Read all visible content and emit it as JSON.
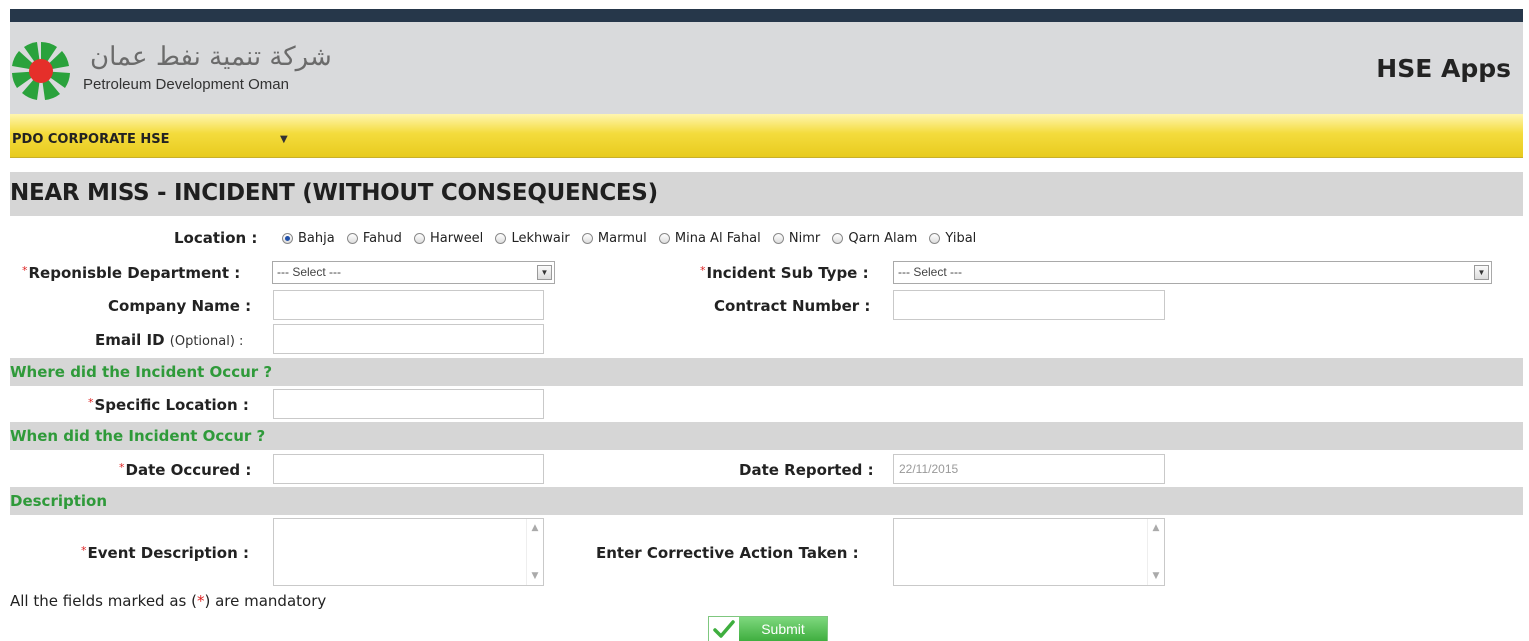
{
  "header": {
    "company_arabic": "شركة تنمية نفط عمان",
    "company_name": "Petroleum Development Oman",
    "app_title": "HSE Apps"
  },
  "nav": {
    "item": "PDO CORPORATE HSE",
    "caret": "▼"
  },
  "page": {
    "title": "NEAR MISS - INCIDENT (WITHOUT CONSEQUENCES)"
  },
  "form": {
    "location_label": "Location :",
    "locations": [
      "Bahja",
      "Fahud",
      "Harweel",
      "Lekhwair",
      "Marmul",
      "Mina Al Fahal",
      "Nimr",
      "Qarn Alam",
      "Yibal"
    ],
    "selected_location": "Bahja",
    "department_label": "Reponisble Department :",
    "department_value": "--- Select ---",
    "incident_subtype_label": "Incident Sub Type :",
    "incident_subtype_value": "--- Select ---",
    "company_name_label": "Company Name :",
    "contract_number_label": "Contract Number :",
    "email_label": "Email ID",
    "email_optional": "(Optional) :",
    "specific_location_label": "Specific Location :",
    "date_occured_label": "Date Occured :",
    "date_reported_label": "Date Reported :",
    "date_reported_value": "22/11/2015",
    "event_description_label": "Event Description :",
    "corrective_action_label": "Enter Corrective Action Taken :",
    "required_marker": "*"
  },
  "sections": {
    "where": "Where did the Incident Occur ?",
    "when": "When did the Incident Occur ?",
    "description": "Description"
  },
  "footer": {
    "mandatory_prefix": "All the fields marked as (",
    "mandatory_star": "*",
    "mandatory_suffix": ") are mandatory",
    "submit_label": "Submit"
  },
  "colors": {
    "header_bar": "#26374a",
    "nav_yellow": "#f4dc3d",
    "section_green": "#2f9a3a",
    "required_red": "#dd2222"
  }
}
